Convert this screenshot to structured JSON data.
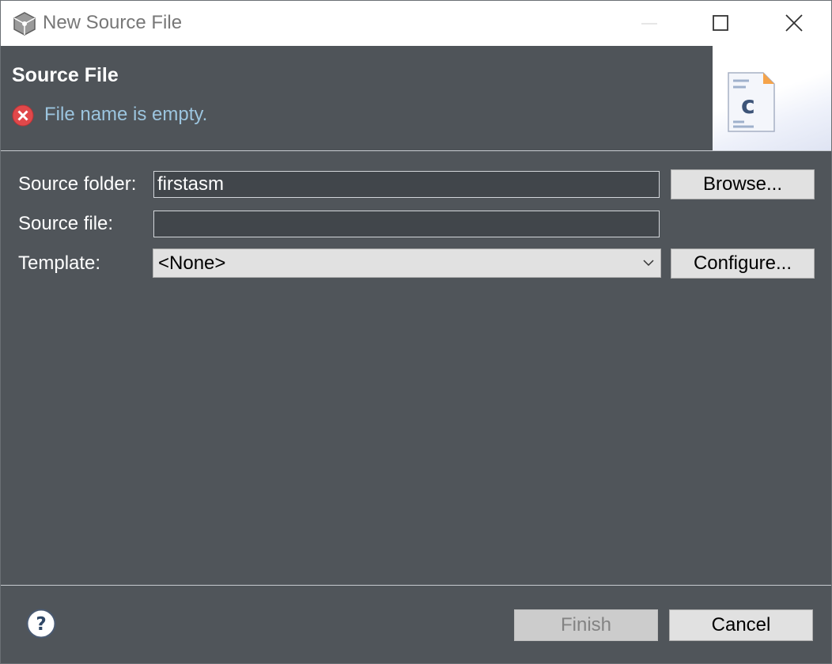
{
  "window": {
    "title": "New Source File",
    "icon": "eclipse-app-icon"
  },
  "header": {
    "title": "Source File",
    "message": "File name is empty.",
    "message_icon": "error-icon",
    "banner_icon": "c-source-file-icon"
  },
  "form": {
    "source_folder": {
      "label": "Source folder:",
      "value": "firstasm"
    },
    "source_file": {
      "label": "Source file:",
      "value": ""
    },
    "template": {
      "label": "Template:",
      "selected": "<None>"
    }
  },
  "buttons": {
    "browse": "Browse...",
    "configure": "Configure...",
    "finish": "Finish",
    "cancel": "Cancel"
  },
  "colors": {
    "dialog_bg": "#50555a",
    "error_text": "#9cc5df",
    "error_red": "#e0484a"
  }
}
